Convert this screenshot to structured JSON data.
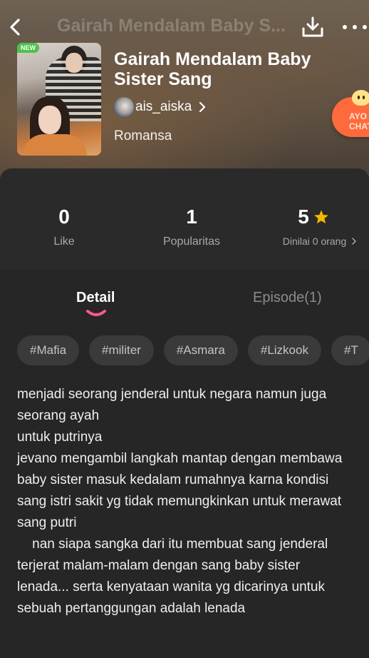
{
  "header": {
    "title": "Gairah Mendalam Baby S...",
    "back_icon": "chevron-left-icon",
    "download_icon": "download-icon",
    "more_icon": "more-dots-icon"
  },
  "book": {
    "badge": "NEW",
    "title": "Gairah Mendalam Baby Sister Sang",
    "author": "ais_aiska",
    "genre": "Romansa"
  },
  "chat_fab": {
    "label": "AYO CHAT"
  },
  "stats": {
    "like": {
      "value": "0",
      "label": "Like"
    },
    "popularity": {
      "value": "1",
      "label": "Popularitas"
    },
    "rating": {
      "value": "5",
      "label": "Dinilai 0 orang"
    }
  },
  "tabs": [
    {
      "label": "Detail",
      "active": true
    },
    {
      "label": "Episode(1)",
      "active": false
    }
  ],
  "tags": [
    "#Mafia",
    "#militer",
    "#Asmara",
    "#Lizkook",
    "#T"
  ],
  "synopsis": "menjadi seorang jenderal untuk negara namun juga seorang ayah\nuntuk putrinya\njevano mengambil langkah mantap dengan membawa baby sister masuk kedalam rumahnya karna kondisi sang istri sakit yg tidak memungkinkan untuk merawat sang putri\n    nan siapa sangka dari itu membuat sang jenderal terjerat malam-malam dengan sang baby sister lenada... serta kenyataan wanita yg dicarinya untuk sebuah pertanggungan adalah lenada",
  "colors": {
    "accent": "#ff5a8a",
    "star": "#f5b800",
    "chat": "#ff6a3d",
    "badge": "#4bc34b"
  }
}
